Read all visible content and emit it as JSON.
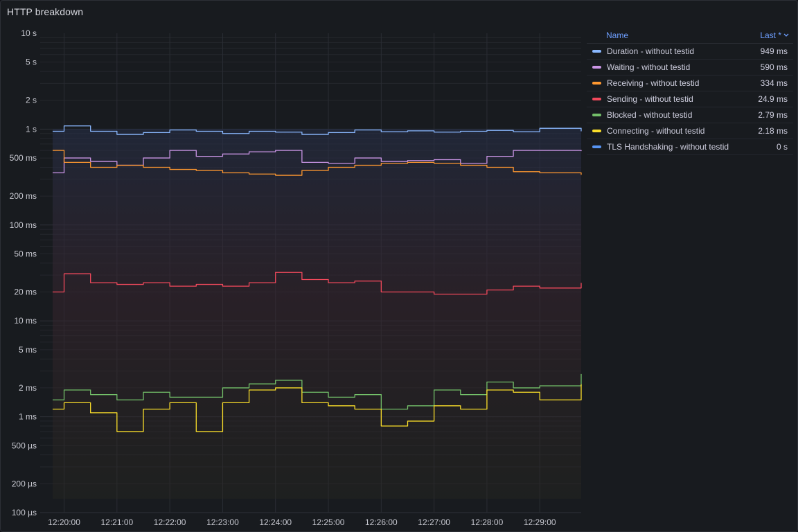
{
  "panel": {
    "title": "HTTP breakdown"
  },
  "legend": {
    "name_header": "Name",
    "last_header": "Last *",
    "sort_icon": "chevron-down-icon",
    "rows": [
      {
        "name": "Duration - without testid",
        "value": "949 ms",
        "color": "#8ab8ff"
      },
      {
        "name": "Waiting - without testid",
        "value": "590 ms",
        "color": "#ca95e5"
      },
      {
        "name": "Receiving - without testid",
        "value": "334 ms",
        "color": "#ff9830"
      },
      {
        "name": "Sending - without testid",
        "value": "24.9 ms",
        "color": "#f2495c"
      },
      {
        "name": "Blocked - without testid",
        "value": "2.79 ms",
        "color": "#73bf69"
      },
      {
        "name": "Connecting - without testid",
        "value": "2.18 ms",
        "color": "#fade2a"
      },
      {
        "name": "TLS Handshaking - without testid",
        "value": "0 s",
        "color": "#5794f2"
      }
    ]
  },
  "chart_data": {
    "type": "line",
    "yscale": "log",
    "ylim_seconds": [
      0.0001,
      10
    ],
    "y_ticks": [
      {
        "label": "10 s",
        "value": 10
      },
      {
        "label": "5 s",
        "value": 5
      },
      {
        "label": "2 s",
        "value": 2
      },
      {
        "label": "1 s",
        "value": 1
      },
      {
        "label": "500 ms",
        "value": 0.5
      },
      {
        "label": "200 ms",
        "value": 0.2
      },
      {
        "label": "100 ms",
        "value": 0.1
      },
      {
        "label": "50 ms",
        "value": 0.05
      },
      {
        "label": "20 ms",
        "value": 0.02
      },
      {
        "label": "10 ms",
        "value": 0.01
      },
      {
        "label": "5 ms",
        "value": 0.005
      },
      {
        "label": "2 ms",
        "value": 0.002
      },
      {
        "label": "1 ms",
        "value": 0.001
      },
      {
        "label": "500 µs",
        "value": 0.0005
      },
      {
        "label": "200 µs",
        "value": 0.0002
      },
      {
        "label": "100 µs",
        "value": 0.0001
      }
    ],
    "x_ticks": [
      "12:20:00",
      "12:21:00",
      "12:22:00",
      "12:23:00",
      "12:24:00",
      "12:25:00",
      "12:26:00",
      "12:27:00",
      "12:28:00",
      "12:29:00"
    ],
    "x_range": [
      "12:19:47",
      "12:29:47"
    ],
    "grid": true,
    "legend_placement": "right",
    "series": [
      {
        "name": "Duration - without testid",
        "color": "#8ab8ff",
        "x": [
          "12:19:47",
          "12:20:00",
          "12:20:30",
          "12:21:00",
          "12:21:30",
          "12:22:00",
          "12:22:30",
          "12:23:00",
          "12:23:30",
          "12:24:00",
          "12:24:30",
          "12:25:00",
          "12:25:30",
          "12:26:00",
          "12:26:30",
          "12:27:00",
          "12:27:30",
          "12:28:00",
          "12:28:30",
          "12:29:00",
          "12:29:47"
        ],
        "y": [
          0.95,
          1.08,
          0.95,
          0.88,
          0.92,
          0.98,
          0.95,
          0.9,
          0.95,
          0.93,
          0.88,
          0.92,
          0.98,
          0.94,
          0.96,
          0.93,
          0.95,
          0.97,
          0.94,
          1.02,
          0.95
        ]
      },
      {
        "name": "Waiting - without testid",
        "color": "#ca95e5",
        "x": [
          "12:19:47",
          "12:20:00",
          "12:20:30",
          "12:21:00",
          "12:21:30",
          "12:22:00",
          "12:22:30",
          "12:23:00",
          "12:23:30",
          "12:24:00",
          "12:24:30",
          "12:25:00",
          "12:25:30",
          "12:26:00",
          "12:26:30",
          "12:27:00",
          "12:27:30",
          "12:28:00",
          "12:28:30",
          "12:29:00",
          "12:29:47"
        ],
        "y": [
          0.35,
          0.5,
          0.46,
          0.42,
          0.5,
          0.6,
          0.52,
          0.55,
          0.58,
          0.6,
          0.45,
          0.44,
          0.5,
          0.46,
          0.47,
          0.48,
          0.44,
          0.52,
          0.6,
          0.6,
          0.59
        ]
      },
      {
        "name": "Receiving - without testid",
        "color": "#ff9830",
        "x": [
          "12:19:47",
          "12:20:00",
          "12:20:30",
          "12:21:00",
          "12:21:30",
          "12:22:00",
          "12:22:30",
          "12:23:00",
          "12:23:30",
          "12:24:00",
          "12:24:30",
          "12:25:00",
          "12:25:30",
          "12:26:00",
          "12:26:30",
          "12:27:00",
          "12:27:30",
          "12:28:00",
          "12:28:30",
          "12:29:00",
          "12:29:47"
        ],
        "y": [
          0.6,
          0.45,
          0.4,
          0.42,
          0.4,
          0.38,
          0.37,
          0.35,
          0.34,
          0.33,
          0.37,
          0.4,
          0.42,
          0.44,
          0.45,
          0.44,
          0.42,
          0.4,
          0.36,
          0.35,
          0.334
        ]
      },
      {
        "name": "Sending - without testid",
        "color": "#f2495c",
        "x": [
          "12:19:47",
          "12:20:00",
          "12:20:30",
          "12:21:00",
          "12:21:30",
          "12:22:00",
          "12:22:30",
          "12:23:00",
          "12:23:30",
          "12:24:00",
          "12:24:30",
          "12:25:00",
          "12:25:30",
          "12:26:00",
          "12:26:30",
          "12:27:00",
          "12:27:30",
          "12:28:00",
          "12:28:30",
          "12:29:00",
          "12:29:47"
        ],
        "y": [
          0.02,
          0.031,
          0.025,
          0.024,
          0.025,
          0.023,
          0.024,
          0.023,
          0.025,
          0.032,
          0.027,
          0.025,
          0.026,
          0.02,
          0.02,
          0.019,
          0.019,
          0.021,
          0.023,
          0.022,
          0.0249
        ]
      },
      {
        "name": "Blocked - without testid",
        "color": "#73bf69",
        "x": [
          "12:19:47",
          "12:20:00",
          "12:20:30",
          "12:21:00",
          "12:21:30",
          "12:22:00",
          "12:22:30",
          "12:23:00",
          "12:23:30",
          "12:24:00",
          "12:24:30",
          "12:25:00",
          "12:25:30",
          "12:26:00",
          "12:26:30",
          "12:27:00",
          "12:27:30",
          "12:28:00",
          "12:28:30",
          "12:29:00",
          "12:29:47"
        ],
        "y": [
          0.0015,
          0.0019,
          0.0017,
          0.0015,
          0.0018,
          0.0016,
          0.0016,
          0.002,
          0.0022,
          0.0024,
          0.0018,
          0.0016,
          0.0017,
          0.0012,
          0.0013,
          0.0019,
          0.0017,
          0.0023,
          0.002,
          0.0021,
          0.00279
        ]
      },
      {
        "name": "Connecting - without testid",
        "color": "#fade2a",
        "x": [
          "12:19:47",
          "12:20:00",
          "12:20:30",
          "12:21:00",
          "12:21:30",
          "12:22:00",
          "12:22:30",
          "12:23:00",
          "12:23:30",
          "12:24:00",
          "12:24:30",
          "12:25:00",
          "12:25:30",
          "12:26:00",
          "12:26:30",
          "12:27:00",
          "12:27:30",
          "12:28:00",
          "12:28:30",
          "12:29:00",
          "12:29:47"
        ],
        "y": [
          0.0012,
          0.0014,
          0.0011,
          0.0007,
          0.0012,
          0.0014,
          0.0007,
          0.0014,
          0.0019,
          0.002,
          0.0014,
          0.0013,
          0.0012,
          0.0008,
          0.0009,
          0.0013,
          0.0012,
          0.0019,
          0.0018,
          0.0015,
          0.00218
        ]
      }
    ]
  }
}
